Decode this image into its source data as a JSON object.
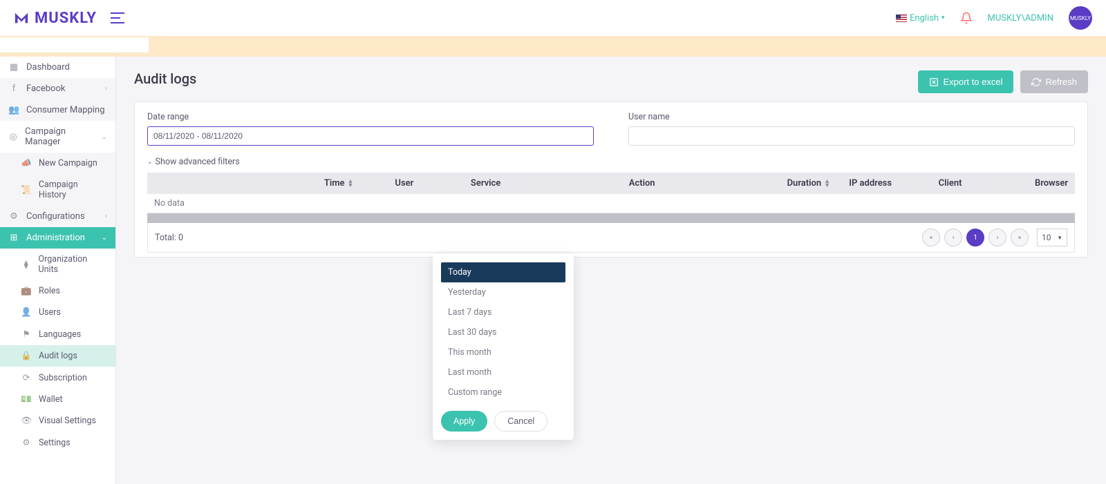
{
  "header": {
    "brand": "MUSKLY",
    "language": "English",
    "username": "MUSKLY\\ADMIN",
    "avatar_text": "MUSKLY"
  },
  "sidebar": {
    "dashboard": "Dashboard",
    "facebook": "Facebook",
    "consumer_mapping": "Consumer Mapping",
    "campaign_manager": "Campaign Manager",
    "new_campaign": "New Campaign",
    "campaign_history": "Campaign History",
    "configurations": "Configurations",
    "administration": "Administration",
    "org_units": "Organization Units",
    "roles": "Roles",
    "users": "Users",
    "languages": "Languages",
    "audit_logs": "Audit logs",
    "subscription": "Subscription",
    "wallet": "Wallet",
    "visual_settings": "Visual Settings",
    "settings": "Settings"
  },
  "page": {
    "title": "Audit logs",
    "export_btn": "Export to excel",
    "refresh_btn": "Refresh"
  },
  "filters": {
    "date_range_label": "Date range",
    "date_range_value": "08/11/2020 - 08/11/2020",
    "username_label": "User name",
    "username_value": "",
    "advanced": "Show advanced filters"
  },
  "datedrop": {
    "today": "Today",
    "yesterday": "Yesterday",
    "last7": "Last 7 days",
    "last30": "Last 30 days",
    "this_month": "This month",
    "last_month": "Last month",
    "custom": "Custom range",
    "apply": "Apply",
    "cancel": "Cancel"
  },
  "table": {
    "headers": {
      "time": "Time",
      "user": "User",
      "service": "Service",
      "action": "Action",
      "duration": "Duration",
      "ip": "IP address",
      "client": "Client",
      "browser": "Browser"
    },
    "nodata": "No data",
    "total": "Total: 0",
    "page_current": "1",
    "page_size": "10"
  }
}
